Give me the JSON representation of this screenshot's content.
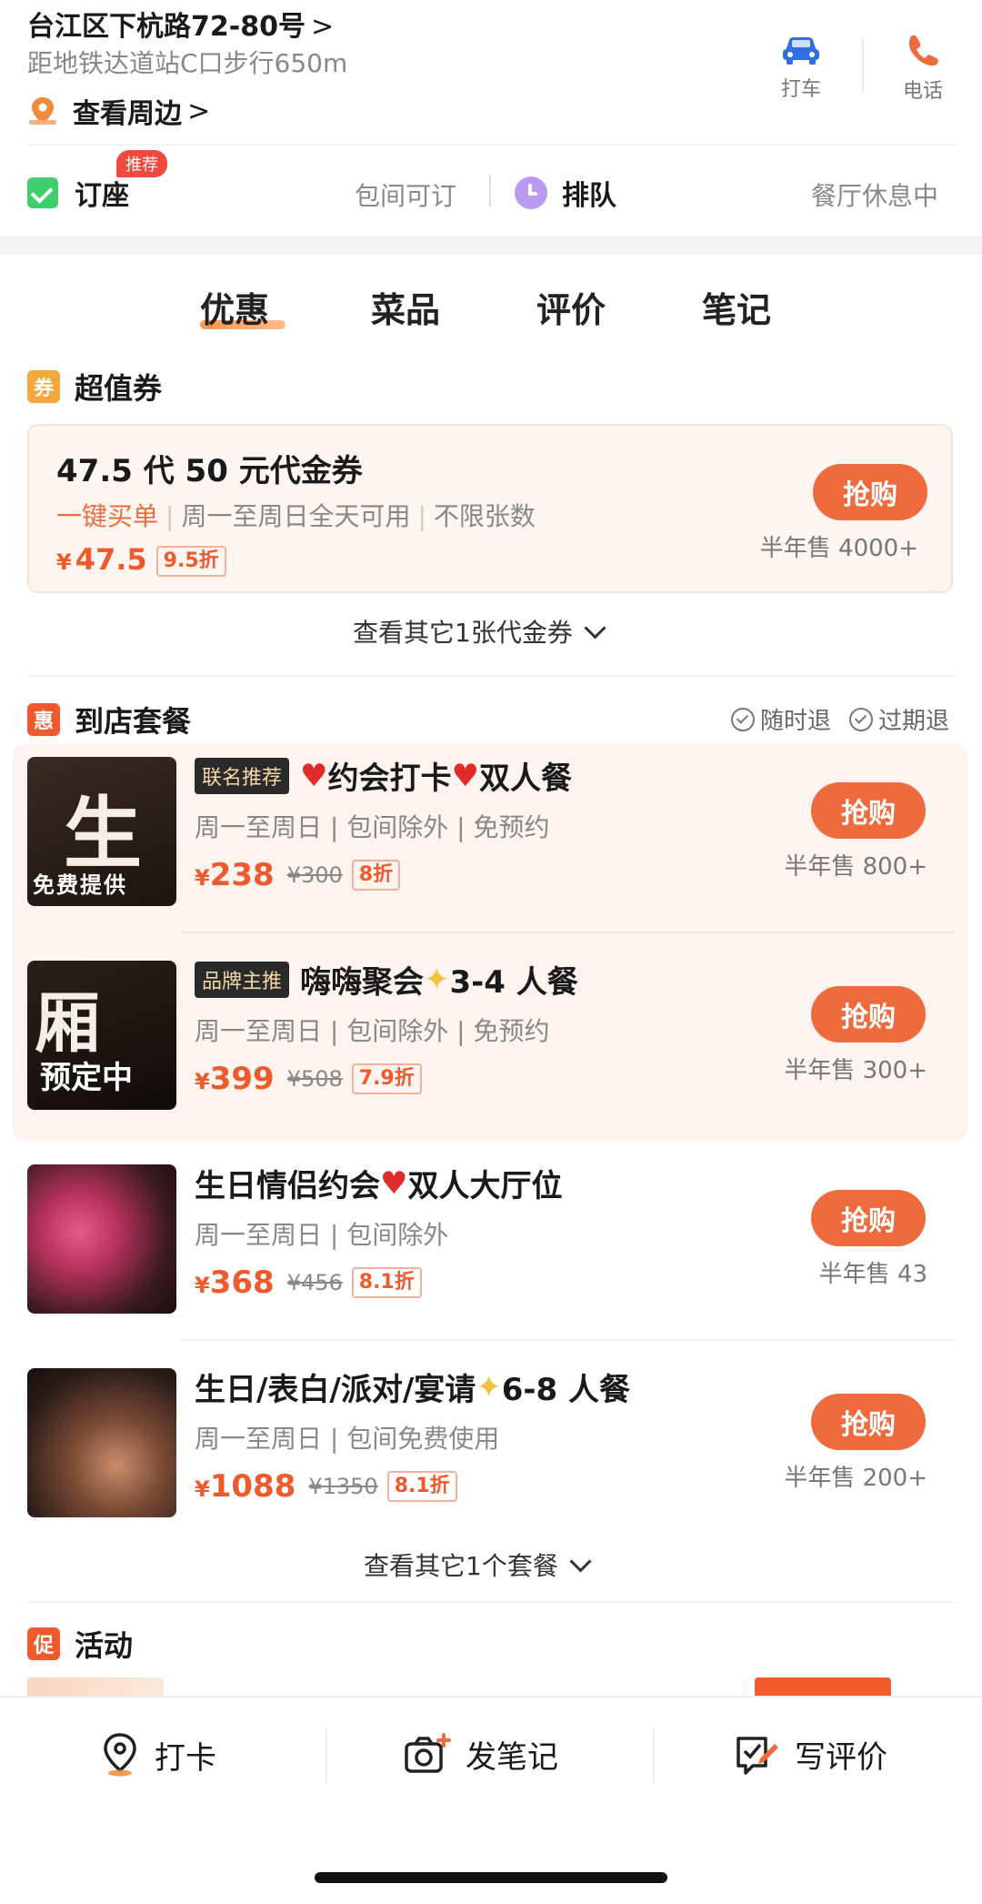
{
  "header": {
    "address": "台江区下杭路72-80号",
    "metro": "距地铁达道站C口步行650m",
    "nearby_label": "查看周边",
    "actions": [
      {
        "label": "打车",
        "icon": "car-icon",
        "color": "#2f6fe0"
      },
      {
        "label": "电话",
        "icon": "phone-icon",
        "color": "#ef6a3d"
      }
    ]
  },
  "booking": {
    "seat_label": "订座",
    "badge": "推荐",
    "private_room": "包间可订",
    "queue_label": "排队",
    "status": "餐厅休息中"
  },
  "tabs": [
    {
      "label": "优惠",
      "active": true
    },
    {
      "label": "菜品",
      "active": false
    },
    {
      "label": "评价",
      "active": false
    },
    {
      "label": "笔记",
      "active": false
    }
  ],
  "vouchers": {
    "icon_text": "券",
    "title": "超值券",
    "item": {
      "name": "47.5 代 50 元代金券",
      "tag_highlight": "一键买单",
      "tag2": "周一至周日全天可用",
      "tag3": "不限张数",
      "price": "47.5",
      "discount": "9.5折",
      "buy_label": "抢购",
      "sold": "半年售 4000+"
    },
    "more": "查看其它1张代金券"
  },
  "packages": {
    "icon_text": "惠",
    "title": "到店套餐",
    "refund1": "随时退",
    "refund2": "过期退",
    "items": [
      {
        "tag": "联名推荐",
        "name_a": "约会打卡",
        "name_b": " 双人餐",
        "desc": "周一至周日 | 包间除外 | 免预约",
        "price": "238",
        "orig": "¥300",
        "discount": "8折",
        "buy": "抢购",
        "sold": "半年售 800+",
        "thumb_text": "生",
        "thumb_sub": "免费提供"
      },
      {
        "tag": "品牌主推",
        "name_a": "嗨嗨聚会",
        "name_b": " 3-4 人餐",
        "desc": "周一至周日 | 包间除外 | 免预约",
        "price": "399",
        "orig": "¥508",
        "discount": "7.9折",
        "buy": "抢购",
        "sold": "半年售 300+",
        "thumb_text": "厢",
        "thumb_sub": "预定中"
      },
      {
        "tag": "",
        "name_a": "生日情侣约会",
        "name_b": "双人大厅位",
        "desc": "周一至周日 | 包间除外",
        "price": "368",
        "orig": "¥456",
        "discount": "8.1折",
        "buy": "抢购",
        "sold": "半年售 43"
      },
      {
        "tag": "",
        "name_a": "生日/表白/派对/宴请",
        "name_b": " 6-8 人餐",
        "desc": "周一至周日 | 包间免费使用",
        "price": "1088",
        "orig": "¥1350",
        "discount": "8.1折",
        "buy": "抢购",
        "sold": "半年售 200+"
      }
    ],
    "more": "查看其它1个套餐"
  },
  "activity": {
    "icon_text": "促",
    "title": "活动"
  },
  "bottom_bar": [
    {
      "label": "打卡",
      "icon": "location-pin-icon"
    },
    {
      "label": "发笔记",
      "icon": "camera-plus-icon"
    },
    {
      "label": "写评价",
      "icon": "edit-review-icon"
    }
  ],
  "colors": {
    "accent": "#ef6a3d",
    "price": "#ee5a2c",
    "voucher_icon": "#f4a73a",
    "package_icon": "#ee5a2c"
  }
}
